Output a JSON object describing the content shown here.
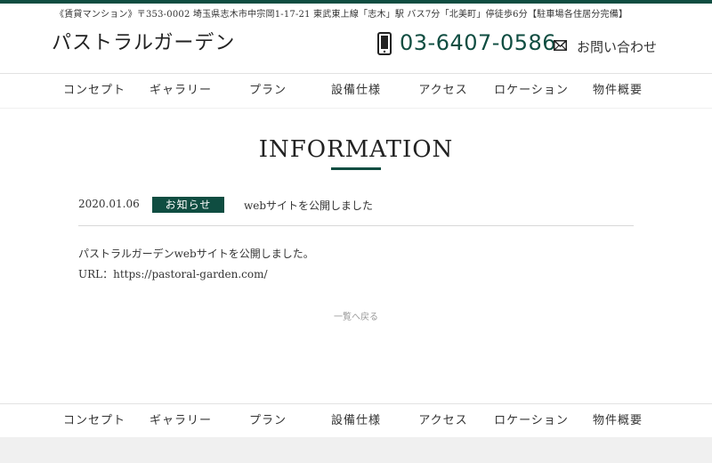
{
  "header": {
    "address": "《賃貸マンション》〒353-0002 埼玉県志木市中宗岡1-17-21 東武東上線「志木」駅 バス7分「北美町」停徒歩6分【駐車場各住居分完備】",
    "site_title": "パストラルガーデン",
    "phone": "03-6407-0586",
    "contact_label": "お問い合わせ"
  },
  "nav": {
    "items": [
      "コンセプト",
      "ギャラリー",
      "プラン",
      "設備仕様",
      "アクセス",
      "ロケーション",
      "物件概要"
    ]
  },
  "main": {
    "title": "INFORMATION",
    "post": {
      "date": "2020.01.06",
      "category": "お知らせ",
      "title": "webサイトを公開しました"
    },
    "body_lines": [
      "パストラルガーデンwebサイトを公開しました。",
      "URL：https://pastoral-garden.com/"
    ],
    "back_link": "一覧へ戻る"
  },
  "colors": {
    "accent": "#0f4d41",
    "footer_bg": "#f0f0f0"
  }
}
